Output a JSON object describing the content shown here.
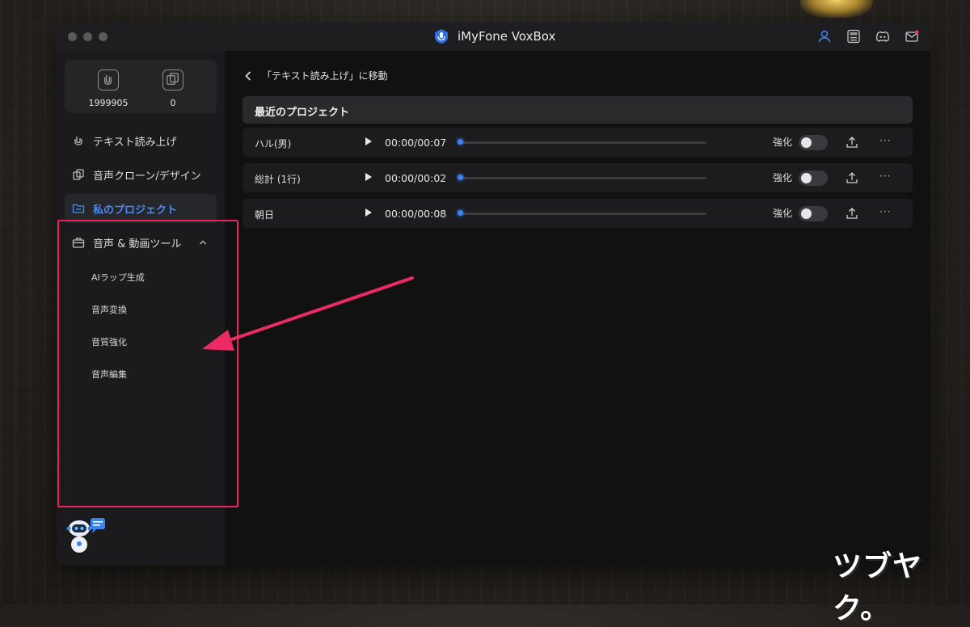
{
  "window": {
    "title": "iMyFone VoxBox"
  },
  "stats": {
    "chars": "1999905",
    "clones": "0"
  },
  "sidebar": {
    "items": [
      {
        "label": "テキスト読み上げ"
      },
      {
        "label": "音声クローン/デザイン"
      },
      {
        "label": "私のプロジェクト"
      },
      {
        "label": "音声 & 動画ツール"
      }
    ],
    "subitems": [
      {
        "label": "AIラップ生成"
      },
      {
        "label": "音声変換"
      },
      {
        "label": "音質強化"
      },
      {
        "label": "音声編集"
      }
    ]
  },
  "main": {
    "back_label": "「テキスト読み上げ」に移動",
    "section_title": "最近のプロジェクト",
    "projects": [
      {
        "name": "ハル(男)",
        "time": "00:00/00:07",
        "enhance_label": "強化",
        "enhance_on": false,
        "progress": 0
      },
      {
        "name": "総計 (1行)",
        "time": "00:00/00:02",
        "enhance_label": "強化",
        "enhance_on": false,
        "progress": 0
      },
      {
        "name": "朝日",
        "time": "00:00/00:08",
        "enhance_label": "強化",
        "enhance_on": false,
        "progress": 0
      }
    ],
    "more_label": "···"
  },
  "watermark": "ツブヤク。",
  "colors": {
    "accent": "#4a8bf5",
    "highlight": "#e8245e",
    "progress": "#3b84f0"
  }
}
